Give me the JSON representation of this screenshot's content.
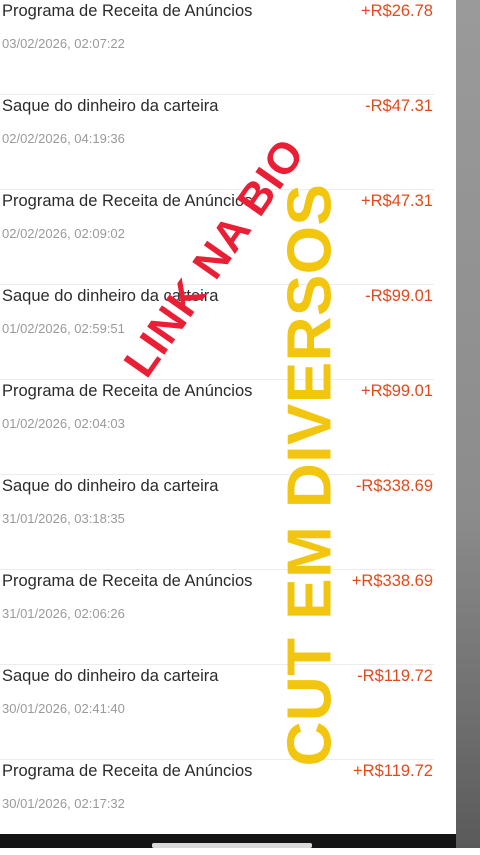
{
  "transactions": [
    {
      "title": "Programa de Receita de Anúncios",
      "date": "03/02/2026, 02:07:22",
      "amount": "+R$26.78"
    },
    {
      "title": "Saque do dinheiro da carteira",
      "date": "02/02/2026, 04:19:36",
      "amount": "-R$47.31"
    },
    {
      "title": "Programa de Receita de Anúncios",
      "date": "02/02/2026, 02:09:02",
      "amount": "+R$47.31"
    },
    {
      "title": "Saque do dinheiro da carteira",
      "date": "01/02/2026, 02:59:51",
      "amount": "-R$99.01"
    },
    {
      "title": "Programa de Receita de Anúncios",
      "date": "01/02/2026, 02:04:03",
      "amount": "+R$99.01"
    },
    {
      "title": "Saque do dinheiro da carteira",
      "date": "31/01/2026, 03:18:35",
      "amount": "-R$338.69"
    },
    {
      "title": "Programa de Receita de Anúncios",
      "date": "31/01/2026, 02:06:26",
      "amount": "+R$338.69"
    },
    {
      "title": "Saque do dinheiro da carteira",
      "date": "30/01/2026, 02:41:40",
      "amount": "-R$119.72"
    },
    {
      "title": "Programa de Receita de Anúncios",
      "date": "30/01/2026, 02:17:32",
      "amount": "+R$119.72"
    }
  ],
  "overlay": {
    "red_text": "LINK NA BIO",
    "yellow_text": "CUT EM DIVERSOS"
  },
  "colors": {
    "amount": "#e2491c",
    "overlay_red": "#ea1f36",
    "overlay_yellow": "#f2c60e"
  }
}
